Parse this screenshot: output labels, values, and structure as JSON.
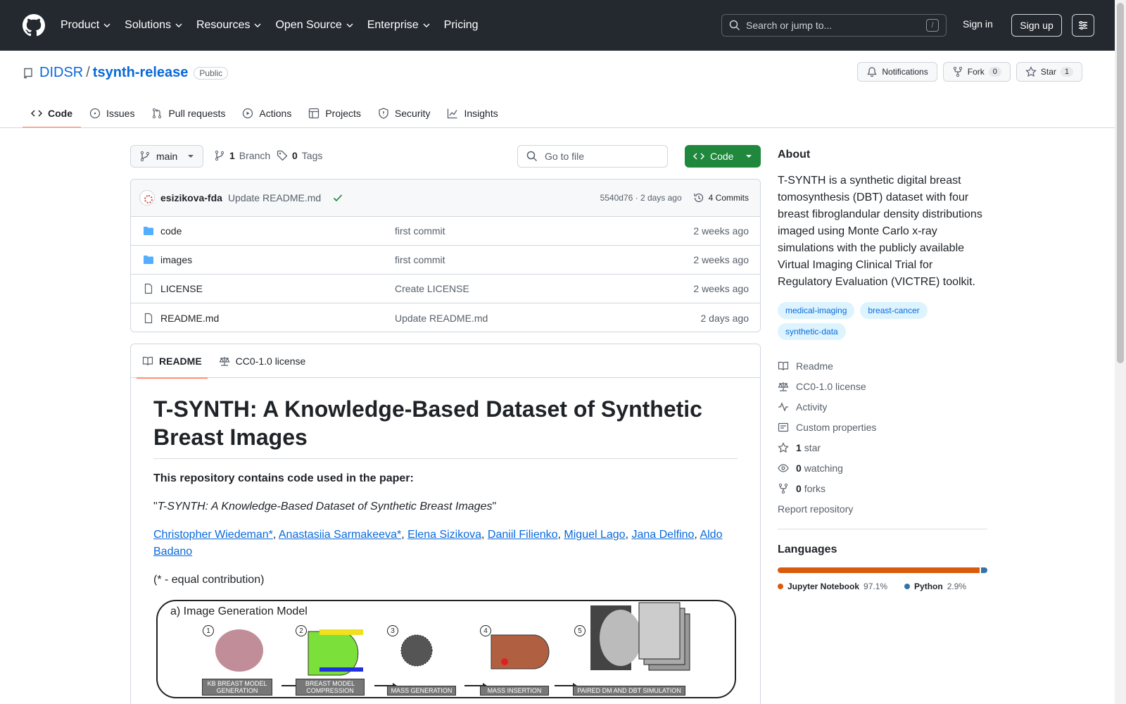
{
  "header": {
    "nav": [
      "Product",
      "Solutions",
      "Resources",
      "Open Source",
      "Enterprise",
      "Pricing"
    ],
    "search_placeholder": "Search or jump to...",
    "search_shortcut": "/",
    "signin": "Sign in",
    "signup": "Sign up"
  },
  "repo": {
    "owner": "DIDSR",
    "separator": "/",
    "name": "tsynth-release",
    "visibility": "Public",
    "notifications_label": "Notifications",
    "fork_label": "Fork",
    "fork_count": "0",
    "star_label": "Star",
    "star_count": "1"
  },
  "tabs": [
    "Code",
    "Issues",
    "Pull requests",
    "Actions",
    "Projects",
    "Security",
    "Insights"
  ],
  "toolbar": {
    "branch": "main",
    "branch_count": "1",
    "branch_label": "Branch",
    "tag_count": "0",
    "tag_label": "Tags",
    "goto_placeholder": "Go to file",
    "code_button": "Code"
  },
  "latest_commit": {
    "author": "esizikova-fda",
    "message": "Update README.md",
    "hash_time": "5540d76 · 2 days ago",
    "commits_count": "4 Commits"
  },
  "files": [
    {
      "type": "folder",
      "name": "code",
      "message": "first commit",
      "date": "2 weeks ago"
    },
    {
      "type": "folder",
      "name": "images",
      "message": "first commit",
      "date": "2 weeks ago"
    },
    {
      "type": "file",
      "name": "LICENSE",
      "message": "Create LICENSE",
      "date": "2 weeks ago"
    },
    {
      "type": "file",
      "name": "README.md",
      "message": "Update README.md",
      "date": "2 days ago"
    }
  ],
  "readme": {
    "tab_readme": "README",
    "tab_license": "CC0-1.0 license",
    "title": "T-SYNTH: A Knowledge-Based Dataset of Synthetic Breast Images",
    "intro": "This repository contains code used in the paper:",
    "quote_open": "\"",
    "paper_title": "T-SYNTH: A Knowledge-Based Dataset of Synthetic Breast Images",
    "quote_close": "\"",
    "authors": [
      "Christopher Wiedeman*",
      "Anastasiia Sarmakeeva*",
      "Elena Sizikova",
      "Daniil Filienko",
      "Miguel Lago",
      "Jana Delfino",
      "Aldo Badano"
    ],
    "author_separator": ", ",
    "note": "(* - equal contribution)",
    "figure": {
      "title": "a) Image Generation Model",
      "stages": [
        {
          "num": "1",
          "label": "KB BREAST MODEL GENERATION"
        },
        {
          "num": "2",
          "label": "BREAST MODEL COMPRESSION"
        },
        {
          "num": "3",
          "label": "MASS GENERATION"
        },
        {
          "num": "4",
          "label": "MASS INSERTION"
        },
        {
          "num": "5",
          "label": "PAIRED DM AND DBT SIMULATION"
        }
      ]
    }
  },
  "about": {
    "heading": "About",
    "description": "T-SYNTH is a synthetic digital breast tomosynthesis (DBT) dataset with four breast fibroglandular density distributions imaged using Monte Carlo x-ray simulations with the publicly available Virtual Imaging Clinical Trial for Regulatory Evaluation (VICTRE) toolkit.",
    "topics": [
      "medical-imaging",
      "breast-cancer",
      "synthetic-data"
    ],
    "links": {
      "readme": "Readme",
      "license": "CC0-1.0 license",
      "activity": "Activity",
      "custom_properties": "Custom properties",
      "stars_count": "1",
      "stars_label": "star",
      "watching_count": "0",
      "watching_label": "watching",
      "forks_count": "0",
      "forks_label": "forks",
      "report": "Report repository"
    }
  },
  "languages": {
    "heading": "Languages",
    "items": [
      {
        "name": "Jupyter Notebook",
        "percent": "97.1%",
        "value": 97.1,
        "color": "#DA5B0B"
      },
      {
        "name": "Python",
        "percent": "2.9%",
        "value": 2.9,
        "color": "#3572A5"
      }
    ]
  }
}
